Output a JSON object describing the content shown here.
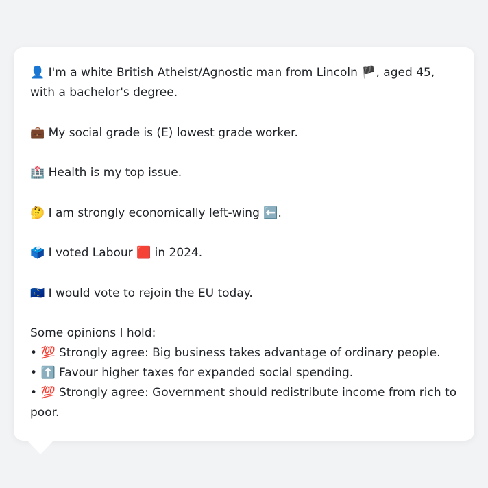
{
  "bio": {
    "identity": {
      "icon": "👤",
      "text_before_flag": " I'm a white British Atheist/Agnostic man from Lincoln ",
      "flag": "🏴",
      "text_after_flag": ", aged 45, with a bachelor's degree."
    },
    "social_grade": {
      "icon": "💼",
      "text": " My social grade is (E) lowest grade worker."
    },
    "top_issue": {
      "icon": "🏥",
      "text": " Health is my top issue."
    },
    "economics": {
      "icon": "🤔",
      "text": " I am strongly economically left-wing ",
      "trail_icon": "⬅️",
      "trail_text": "."
    },
    "vote": {
      "icon": "🗳️",
      "text_before": " I voted Labour ",
      "party_icon": "🟥",
      "text_after": " in 2024."
    },
    "eu": {
      "icon": "🇪🇺",
      "text": " I would vote to rejoin the EU today."
    }
  },
  "opinions": {
    "heading": "Some opinions I hold:",
    "items": [
      {
        "bullet": "•",
        "icon": "💯",
        "text": " Strongly agree: Big business takes advantage of ordinary people."
      },
      {
        "bullet": "•",
        "icon": "⬆️",
        "text": " Favour higher taxes for expanded social spending."
      },
      {
        "bullet": "•",
        "icon": "💯",
        "text": " Strongly agree: Government should redistribute income from rich to poor."
      }
    ]
  }
}
